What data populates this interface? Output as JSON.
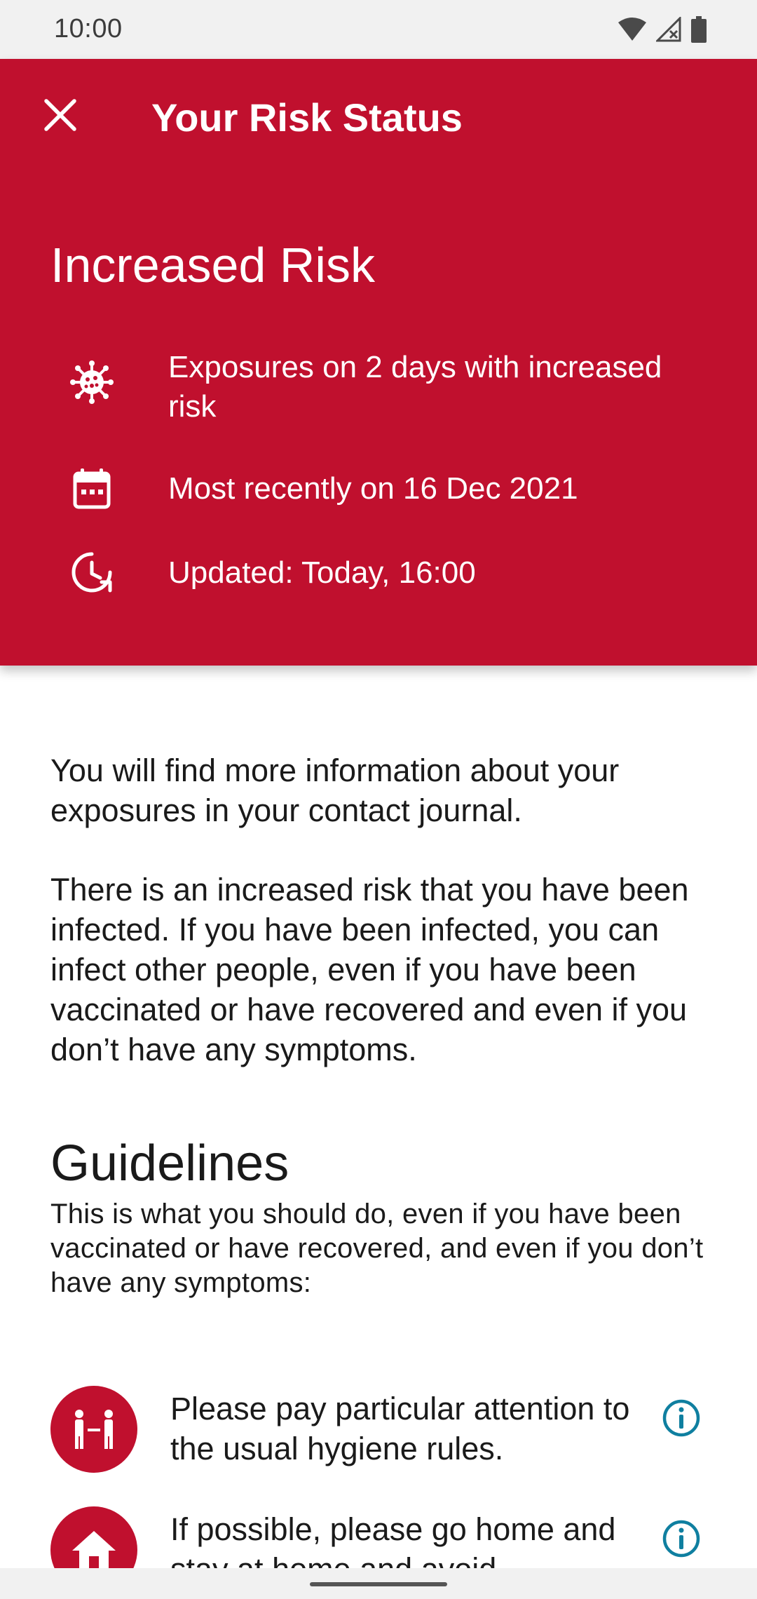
{
  "status_bar": {
    "time": "10:00"
  },
  "header": {
    "title": "Your Risk Status",
    "risk_level": "Increased Risk",
    "background_color": "#c0102e",
    "info_rows": [
      {
        "icon": "virus-icon",
        "text": "Exposures on 2 days with increased risk"
      },
      {
        "icon": "calendar-icon",
        "text": "Most recently on 16 Dec 2021"
      },
      {
        "icon": "clock-update-icon",
        "text": "Updated: Today, 16:00"
      }
    ]
  },
  "body": {
    "paragraphs": [
      "You will find more information about your exposures in your contact journal.",
      "There is an increased risk that you have been infected. If you have been infected, you can infect other people, even if you have been vaccinated or have recovered and even if you don’t have any symptoms."
    ],
    "guidelines": {
      "heading": "Guidelines",
      "subheading": "This is what you should do, even if you have been vaccinated or have recovered, and even if you don’t have any symptoms:",
      "items": [
        {
          "icon": "distance-icon",
          "text": "Please pay particular attention to the usual hygiene rules."
        },
        {
          "icon": "home-icon",
          "text": "If possible, please go home and stay at home and avoid"
        }
      ]
    }
  }
}
